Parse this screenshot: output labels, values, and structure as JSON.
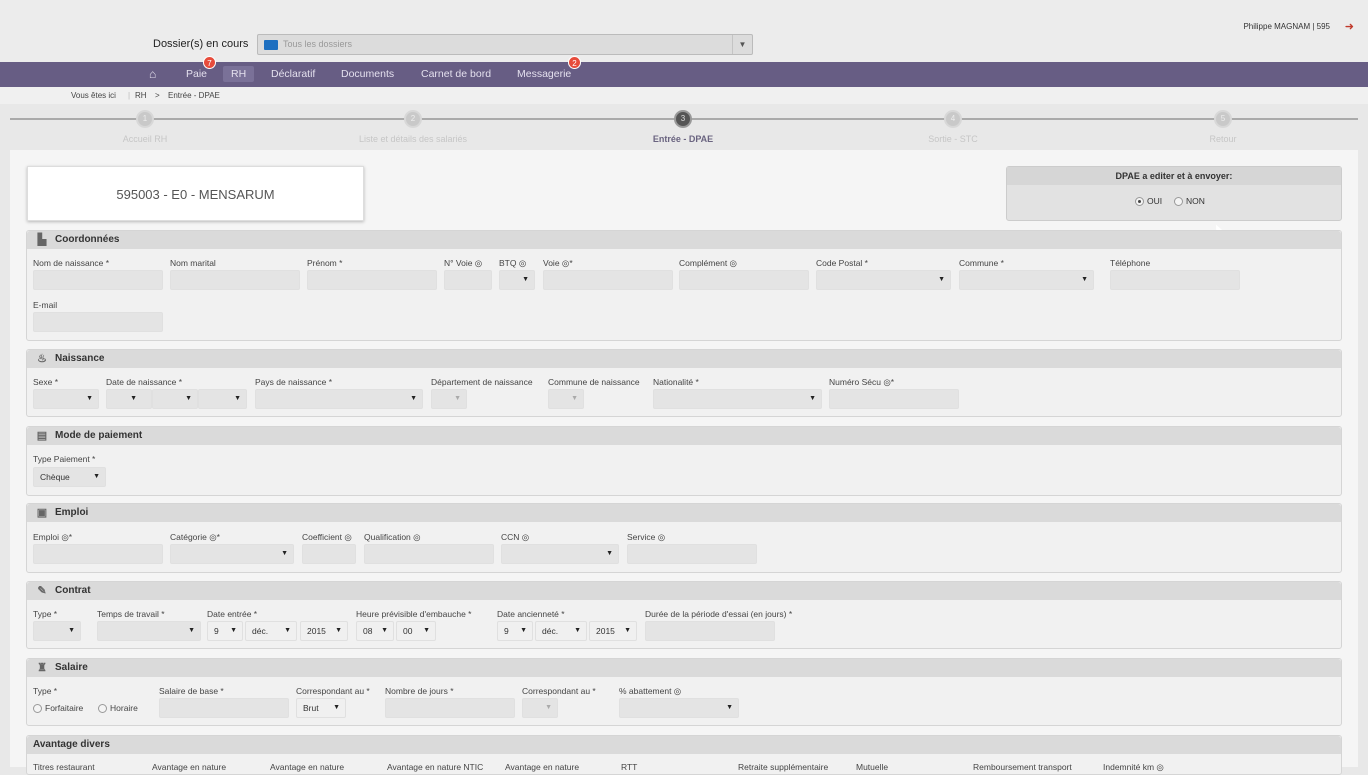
{
  "header": {
    "dossier_label": "Dossier(s) en cours",
    "dossier_value": "Tous les dossiers",
    "user": "Philippe MAGNAM | 595"
  },
  "nav": {
    "items": [
      "Paie",
      "RH",
      "Déclaratif",
      "Documents",
      "Carnet de bord",
      "Messagerie"
    ],
    "paie_badge": "7",
    "messagerie_badge": "2"
  },
  "breadcrumb": {
    "prefix": "Vous êtes ici",
    "items": [
      "RH",
      "Entrée - DPAE"
    ],
    "sep": ">"
  },
  "steps": [
    {
      "n": "1",
      "label": "Accueil RH"
    },
    {
      "n": "2",
      "label": "Liste et détails des salariés"
    },
    {
      "n": "3",
      "label": "Entrée - DPAE"
    },
    {
      "n": "4",
      "label": "Sortie - STC"
    },
    {
      "n": "5",
      "label": "Retour"
    }
  ],
  "company": "595003 - E0 - MENSARUM",
  "dpae": {
    "title": "DPAE a editer et à envoyer:",
    "oui": "OUI",
    "non": "NON"
  },
  "coord": {
    "title": "Coordonnées",
    "nom": "Nom de naissance *",
    "marital": "Nom marital",
    "prenom": "Prénom *",
    "nvoie": "N° Voie ◎",
    "btq": "BTQ ◎",
    "voie": "Voie ◎*",
    "complement": "Complément ◎",
    "cp": "Code Postal *",
    "commune": "Commune *",
    "tel": "Téléphone",
    "email": "E-mail"
  },
  "naissance": {
    "title": "Naissance",
    "sexe": "Sexe *",
    "date": "Date de naissance *",
    "pays": "Pays de naissance *",
    "dept": "Département de naissance",
    "commune": "Commune de naissance",
    "nat": "Nationalité *",
    "secu": "Numéro Sécu ◎*"
  },
  "paiement": {
    "title": "Mode de paiement",
    "type": "Type Paiement *",
    "value": "Chèque"
  },
  "emploi": {
    "title": "Emploi",
    "emploi": "Emploi ◎*",
    "categorie": "Catégorie ◎*",
    "coef": "Coefficient ◎",
    "qualif": "Qualification ◎",
    "ccn": "CCN ◎",
    "service": "Service ◎"
  },
  "contrat": {
    "title": "Contrat",
    "type": "Type *",
    "temps": "Temps de travail *",
    "entree": "Date entrée *",
    "heure": "Heure prévisible d'embauche *",
    "anc": "Date ancienneté *",
    "duree": "Durée de la période d'essai (en jours) *",
    "day": "9",
    "month": "déc.",
    "year": "2015",
    "hh": "08",
    "mm": "00",
    "aday": "9",
    "amonth": "déc.",
    "ayear": "2015"
  },
  "salaire": {
    "title": "Salaire",
    "type": "Type *",
    "forfait": "Forfaitaire",
    "horaire": "Horaire",
    "base": "Salaire de base *",
    "corr": "Correspondant au *",
    "corr_val": "Brut",
    "jours": "Nombre de jours *",
    "corr2": "Correspondant au *",
    "abat": "% abattement ◎"
  },
  "avantage": {
    "title": "Avantage divers",
    "cols": [
      "Titres restaurant",
      "Avantage en nature",
      "Avantage en nature",
      "Avantage en nature NTIC",
      "Avantage en nature",
      "RTT",
      "Retraite supplémentaire",
      "Mutuelle",
      "Remboursement transport",
      "Indemnité km ◎"
    ]
  }
}
